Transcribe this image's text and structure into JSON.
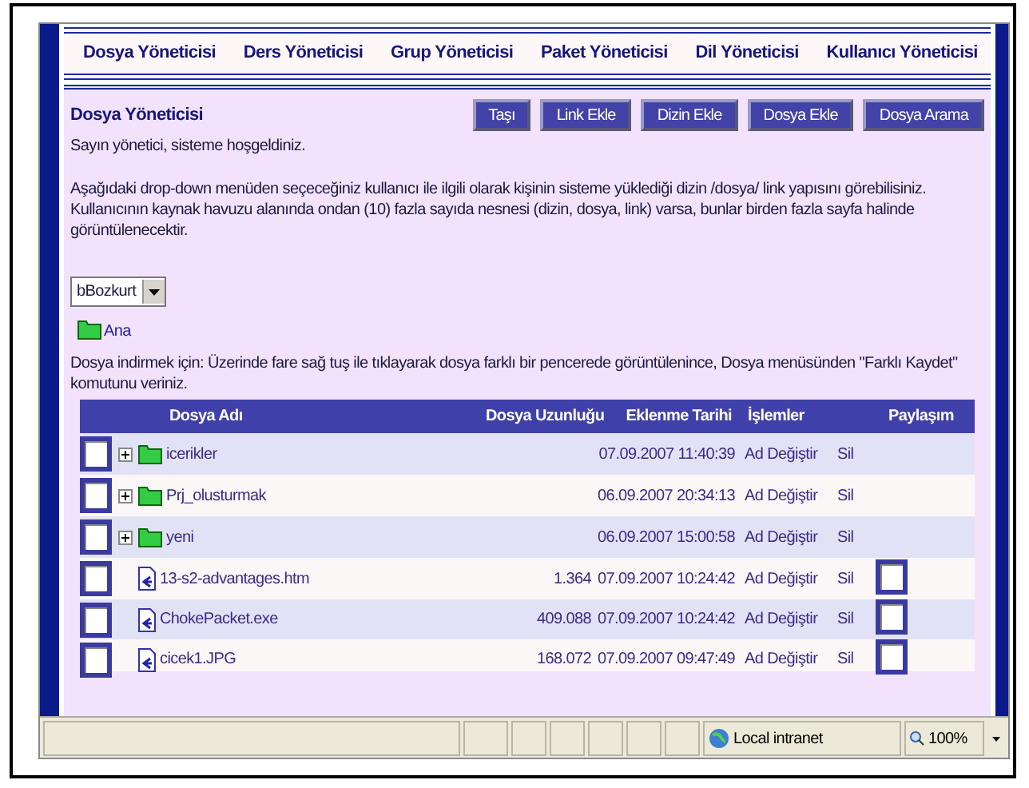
{
  "nav": [
    {
      "label": "Dosya Yöneticisi"
    },
    {
      "label": "Ders Yöneticisi"
    },
    {
      "label": "Grup Yöneticisi"
    },
    {
      "label": "Paket Yöneticisi"
    },
    {
      "label": "Dil Yöneticisi"
    },
    {
      "label": "Kullanıcı Yöneticisi"
    }
  ],
  "panel": {
    "title": "Dosya Yöneticisi",
    "buttons": [
      "Taşı",
      "Link Ekle",
      "Dizin Ekle",
      "Dosya Ekle",
      "Dosya Arama"
    ],
    "welcome": "Sayın yönetici, sisteme hoşgeldiniz.",
    "intro": "Aşağıdaki drop-down menüden seçeceğiniz kullanıcı ile ilgili olarak kişinin sisteme yüklediği dizin /dosya/ link yapısını görebilisiniz. Kullanıcının kaynak havuzu alanında ondan (10) fazla sayıda nesnesi (dizin, dosya, link) varsa, bunlar birden fazla sayfa halinde görüntülenecektir.",
    "user_select": "bBozkurt",
    "root_link": "Ana",
    "download_note": "Dosya indirmek için: Üzerinde fare sağ tuş ile tıklayarak dosya farklı bir pencerede görüntülenince, Dosya menüsünden \"Farklı Kaydet\" komutunu veriniz."
  },
  "table": {
    "columns": [
      "Dosya Adı",
      "Dosya Uzunluğu",
      "Eklenme Tarihi",
      "İşlemler",
      "Paylaşım"
    ],
    "rows": [
      {
        "kind": "folder",
        "checked": false,
        "name": "icerikler",
        "date": "07.09.2007 11:40:39",
        "rename": "Ad Değiştir",
        "delete": "Sil"
      },
      {
        "kind": "folder",
        "checked": false,
        "name": "Prj_olusturmak",
        "date": "06.09.2007 20:34:13",
        "rename": "Ad Değiştir",
        "delete": "Sil"
      },
      {
        "kind": "folder",
        "checked": false,
        "name": "yeni",
        "date": "06.09.2007 15:00:58",
        "rename": "Ad Değiştir",
        "delete": "Sil"
      },
      {
        "kind": "file",
        "checked": false,
        "name": "13-s2-advantages.htm",
        "size": "1.364",
        "date": "07.09.2007 10:24:42",
        "rename": "Ad Değiştir",
        "delete": "Sil",
        "shared": false
      },
      {
        "kind": "file",
        "checked": false,
        "name": "ChokePacket.exe",
        "size": "409.088",
        "date": "07.09.2007 10:24:42",
        "rename": "Ad Değiştir",
        "delete": "Sil",
        "shared": false
      },
      {
        "kind": "file",
        "checked": false,
        "name": "cicek1.JPG",
        "size": "168.072",
        "date": "07.09.2007 09:47:49",
        "rename": "Ad Değiştir",
        "delete": "Sil",
        "shared": false
      }
    ]
  },
  "status_bar": {
    "zone": "Local intranet",
    "zoom": "100%"
  }
}
